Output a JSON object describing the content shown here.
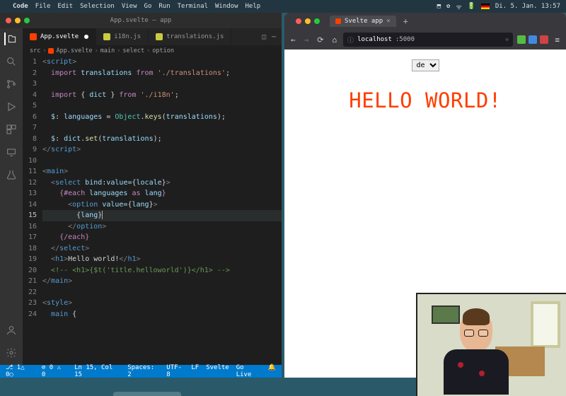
{
  "mac_menu": {
    "app": "Code",
    "items": [
      "File",
      "Edit",
      "Selection",
      "View",
      "Go",
      "Run",
      "Terminal",
      "Window",
      "Help"
    ],
    "clock": "Di. 5. Jan. 13:57"
  },
  "vscode": {
    "title": "App.svelte — app",
    "tabs": [
      {
        "label": "App.svelte",
        "icon": "svelte",
        "active": true,
        "dirty": true
      },
      {
        "label": "i18n.js",
        "icon": "js",
        "active": false,
        "dirty": false
      },
      {
        "label": "translations.js",
        "icon": "js",
        "active": false,
        "dirty": false
      }
    ],
    "breadcrumb": [
      "src",
      "App.svelte",
      "main",
      "select",
      "option"
    ],
    "code_lines": [
      {
        "n": 1,
        "html": "<span class='t-brkt'>&lt;</span><span class='t-tag'>script</span><span class='t-brkt'>&gt;</span>"
      },
      {
        "n": 2,
        "html": "  <span class='t-kw'>import</span> <span class='t-var'>translations</span> <span class='t-kw'>from</span> <span class='t-str'>'./translations'</span>;"
      },
      {
        "n": 3,
        "html": ""
      },
      {
        "n": 4,
        "html": "  <span class='t-kw'>import</span> { <span class='t-var'>dict</span> } <span class='t-kw'>from</span> <span class='t-str'>'./i18n'</span>;"
      },
      {
        "n": 5,
        "html": ""
      },
      {
        "n": 6,
        "html": "  <span class='t-var'>$</span>: <span class='t-var'>languages</span> = <span class='t-type'>Object</span>.<span class='t-fn'>keys</span>(<span class='t-var'>translations</span>);"
      },
      {
        "n": 7,
        "html": ""
      },
      {
        "n": 8,
        "html": "  <span class='t-var'>$</span>: <span class='t-var'>dict</span>.<span class='t-fn'>set</span>(<span class='t-var'>translations</span>);"
      },
      {
        "n": 9,
        "html": "<span class='t-brkt'>&lt;/</span><span class='t-tag'>script</span><span class='t-brkt'>&gt;</span>"
      },
      {
        "n": 10,
        "html": ""
      },
      {
        "n": 11,
        "html": "<span class='t-brkt'>&lt;</span><span class='t-tag'>main</span><span class='t-brkt'>&gt;</span>"
      },
      {
        "n": 12,
        "html": "  <span class='t-brkt'>&lt;</span><span class='t-tag'>select</span> <span class='t-attr'>bind</span>:<span class='t-attr'>value=</span>{<span class='t-var'>locale</span>}<span class='t-brkt'>&gt;</span>"
      },
      {
        "n": 13,
        "html": "    <span class='t-svelte'>{#each</span> <span class='t-var'>languages</span> <span class='t-svelte'>as</span> <span class='t-var'>lang</span><span class='t-svelte'>}</span>"
      },
      {
        "n": 14,
        "html": "      <span class='t-brkt'>&lt;</span><span class='t-tag'>option</span> <span class='t-attr'>value=</span>{<span class='t-var'>lang</span>}<span class='t-brkt'>&gt;</span>"
      },
      {
        "n": 15,
        "html": "        {<span class='t-var'>lang</span>}<span class='cursor-caret'></span>",
        "current": true
      },
      {
        "n": 16,
        "html": "      <span class='t-brkt'>&lt;/</span><span class='t-tag'>option</span><span class='t-brkt'>&gt;</span>"
      },
      {
        "n": 17,
        "html": "    <span class='t-svelte'>{/each}</span>"
      },
      {
        "n": 18,
        "html": "  <span class='t-brkt'>&lt;/</span><span class='t-tag'>select</span><span class='t-brkt'>&gt;</span>"
      },
      {
        "n": 19,
        "html": "  <span class='t-brkt'>&lt;</span><span class='t-tag'>h1</span><span class='t-brkt'>&gt;</span><span class='t-txt'>Hello world!</span><span class='t-brkt'>&lt;/</span><span class='t-tag'>h1</span><span class='t-brkt'>&gt;</span>"
      },
      {
        "n": 20,
        "html": "  <span class='t-cmt'>&lt;!-- &lt;h1&gt;{$t('title.helloworld')}&lt;/h1&gt; --&gt;</span>"
      },
      {
        "n": 21,
        "html": "<span class='t-brkt'>&lt;/</span><span class='t-tag'>main</span><span class='t-brkt'>&gt;</span>"
      },
      {
        "n": 22,
        "html": ""
      },
      {
        "n": 23,
        "html": "<span class='t-brkt'>&lt;</span><span class='t-tag'>style</span><span class='t-brkt'>&gt;</span>"
      },
      {
        "n": 24,
        "html": "  <span class='t-tag'>main</span> {"
      }
    ],
    "status": {
      "branch_icon": "⎇",
      "branch": "1△ 0○",
      "errors": "⊘ 0 ⚠ 0",
      "cursor": "Ln 15, Col 15",
      "spaces": "Spaces: 2",
      "encoding": "UTF-8",
      "eol": "LF",
      "lang": "Svelte",
      "golive": "Go Live",
      "bell": "🔔"
    }
  },
  "browser": {
    "tab_title": "Svelte app",
    "url_host": "localhost",
    "url_port": ":5000",
    "page": {
      "select_value": "de",
      "heading": "HELLO WORLD!"
    }
  }
}
